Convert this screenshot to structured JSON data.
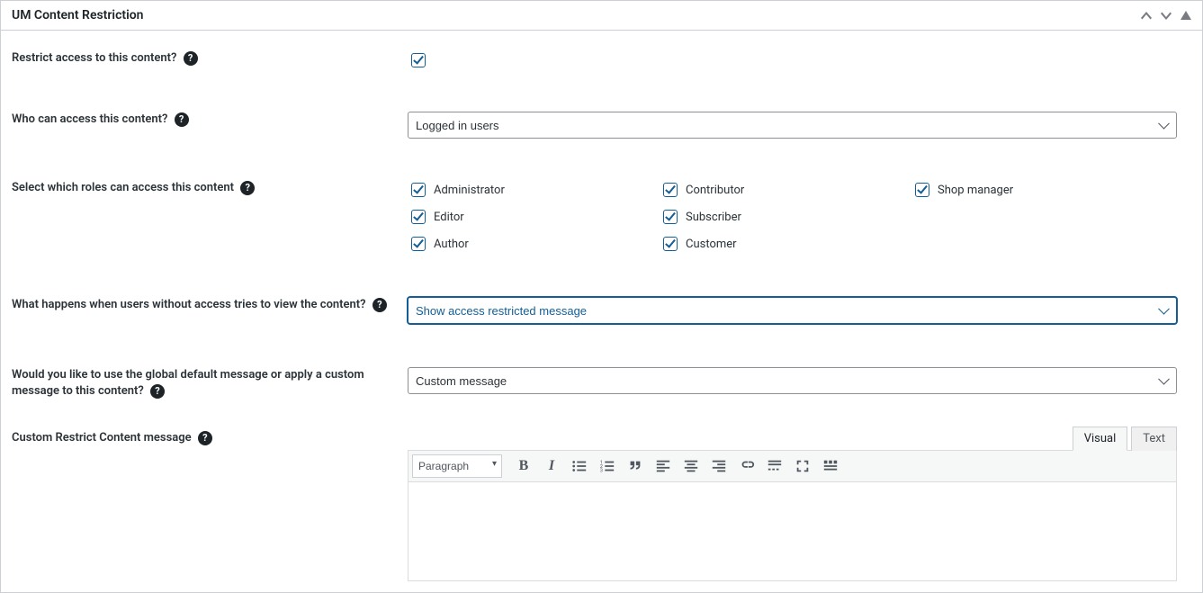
{
  "panel": {
    "title": "UM Content Restriction"
  },
  "fields": {
    "restrict": {
      "label": "Restrict access to this content?",
      "checked": true
    },
    "access": {
      "label": "Who can access this content?",
      "value": "Logged in users"
    },
    "roles": {
      "label": "Select which roles can access this content",
      "items": [
        {
          "label": "Administrator",
          "checked": true
        },
        {
          "label": "Contributor",
          "checked": true
        },
        {
          "label": "Shop manager",
          "checked": true
        },
        {
          "label": "Editor",
          "checked": true
        },
        {
          "label": "Subscriber",
          "checked": true
        },
        {
          "label": "",
          "checked": false
        },
        {
          "label": "Author",
          "checked": true
        },
        {
          "label": "Customer",
          "checked": true
        },
        {
          "label": "",
          "checked": false
        }
      ]
    },
    "noaccess": {
      "label": "What happens when users without access tries to view the content?",
      "value": "Show access restricted message"
    },
    "message_type": {
      "label": "Would you like to use the global default message or apply a custom message to this content?",
      "value": "Custom message"
    },
    "custom_msg": {
      "label": "Custom Restrict Content message"
    }
  },
  "editor": {
    "tabs": {
      "visual": "Visual",
      "text": "Text",
      "active": "visual"
    },
    "format": "Paragraph",
    "buttons": [
      "bold",
      "italic",
      "bullist",
      "numlist",
      "quote",
      "alignleft",
      "aligncenter",
      "alignright",
      "link",
      "more",
      "fullscreen",
      "toolbar-toggle"
    ]
  }
}
